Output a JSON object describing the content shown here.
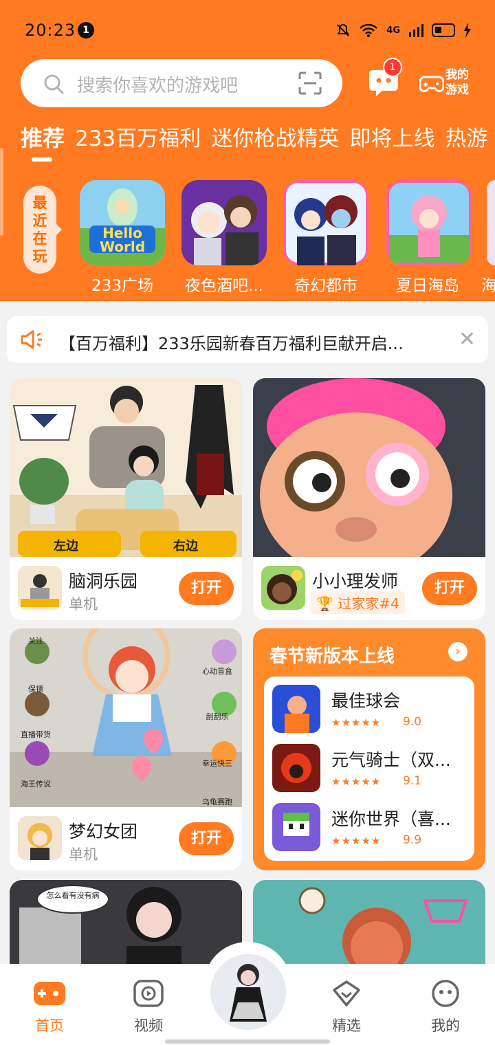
{
  "status_bar": {
    "time": "20:23",
    "notification_count": "1",
    "network": "4G"
  },
  "search": {
    "placeholder": "搜索你喜欢的游戏吧"
  },
  "header": {
    "message_badge": "1",
    "my_games_label_1": "我的",
    "my_games_label_2": "游戏"
  },
  "tabs": [
    "推荐",
    "233百万福利",
    "迷你枪战精英",
    "即将上线",
    "热游"
  ],
  "recent": {
    "tag": [
      "最",
      "近",
      "在",
      "玩"
    ],
    "games": [
      {
        "name": "233广场",
        "icon_text": "Hello World"
      },
      {
        "name": "夜色酒吧..."
      },
      {
        "name": "奇幻都市"
      },
      {
        "name": "夏日海岛"
      },
      {
        "name": "海"
      }
    ]
  },
  "announcement": {
    "text": "【百万福利】233乐园新春百万福利巨献开启..."
  },
  "cards": [
    {
      "name": "脑洞乐园",
      "sub": "单机",
      "open": "打开",
      "img_left": "左边",
      "img_right": "右边"
    },
    {
      "name": "小小理发师",
      "tag": "过家家#4",
      "open": "打开"
    },
    {
      "name": "梦幻女团",
      "sub": "单机",
      "open": "打开",
      "img_labels": [
        "关注",
        "保镖",
        "直播带货",
        "海王传说",
        "心动盲盒",
        "刮刮乐",
        "幸运快三",
        "乌龟赛跑"
      ]
    }
  ],
  "spring": {
    "title": "春节新版本上线",
    "games": [
      {
        "name": "最佳球会",
        "score": "9.0",
        "stars": "★★★★★"
      },
      {
        "name": "元气骑士（双...",
        "score": "9.1",
        "stars": "★★★★★"
      },
      {
        "name": "迷你世界（喜...",
        "score": "9.9",
        "stars": "★★★★★"
      }
    ]
  },
  "partial_cards": {
    "bubble_text": "怎么看有没有病"
  },
  "bottom_nav": [
    {
      "label": "首页",
      "icon": "gamepad-icon"
    },
    {
      "label": "视频",
      "icon": "play-icon"
    },
    {
      "label": "",
      "icon": "avatar"
    },
    {
      "label": "精选",
      "icon": "heart-icon"
    },
    {
      "label": "我的",
      "icon": "face-icon"
    }
  ],
  "colors": {
    "brand": "#ff7a21",
    "badge": "#ff3b30"
  }
}
